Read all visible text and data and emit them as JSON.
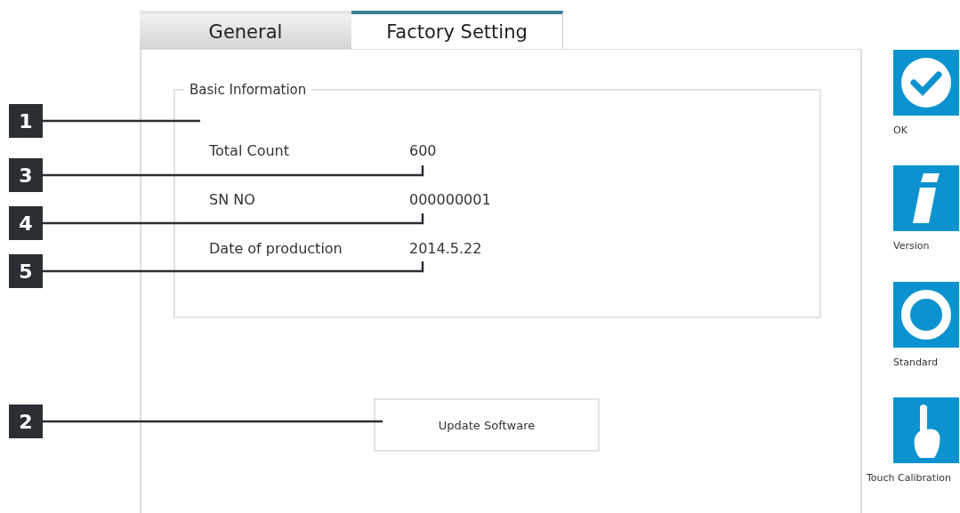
{
  "tabs": [
    {
      "label": "General",
      "selected": false
    },
    {
      "label": "Factory Setting",
      "selected": true
    }
  ],
  "group": {
    "title": "Basic Information",
    "rows": [
      {
        "label": "Total Count",
        "value": "600"
      },
      {
        "label": "SN NO",
        "value": "000000001"
      },
      {
        "label": "Date of production",
        "value": "2014.5.22"
      }
    ]
  },
  "update_button": "Update Software",
  "side_actions": [
    {
      "kind": "check",
      "label": "OK"
    },
    {
      "kind": "info",
      "label": "Version"
    },
    {
      "kind": "ring",
      "label": "Standard"
    },
    {
      "kind": "hand",
      "label": "Touch Calibration"
    }
  ],
  "callouts": [
    "1",
    "3",
    "4",
    "5",
    "2"
  ]
}
